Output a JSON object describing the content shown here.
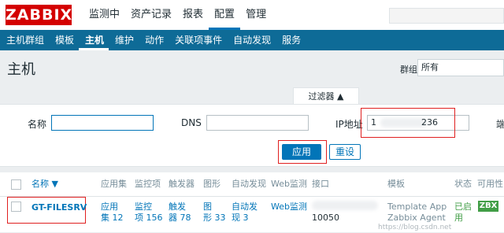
{
  "top": {
    "logo": "ZABBIX",
    "nav": [
      "监测中",
      "资产记录",
      "报表",
      "配置",
      "管理"
    ],
    "active_nav": "配置"
  },
  "subnav": [
    "主机群组",
    "模板",
    "主机",
    "维护",
    "动作",
    "关联项事件",
    "自动发现",
    "服务"
  ],
  "page": {
    "title": "主机",
    "group_label": "群组",
    "group_value": "所有"
  },
  "filter": {
    "tab_label": "过滤器 ▲",
    "name_label": "名称",
    "name_value": "",
    "dns_label": "DNS",
    "dns_value": "",
    "ip_label": "IP地址",
    "ip_prefix": "1",
    "ip_suffix": "236",
    "port_label_partial": "端",
    "apply_label": "应用",
    "reset_label": "重设"
  },
  "table": {
    "headers": {
      "name": "名称 ▼",
      "apps": "应用集",
      "items": "监控项",
      "triggers": "触发器",
      "graphs": "图形",
      "discovery": "自动发现",
      "web": "Web监测",
      "interface": "接口",
      "template": "模板",
      "status": "状态",
      "availability": "可用性"
    },
    "row": {
      "name": "GT-FILESRV",
      "apps_line1": "应用",
      "apps_line2": "集 12",
      "items_line1": "监控",
      "items_line2": "项 156",
      "triggers_line1": "触发",
      "triggers_line2": "器 78",
      "graphs_line1": "图",
      "graphs_line2": "形 33",
      "discovery_line1": "自动发",
      "discovery_line2": "现 3",
      "web": "Web监测",
      "interface_port": "10050",
      "template_line1": "Template App",
      "template_line2": "Zabbix Agent",
      "status_line1": "已启",
      "status_line2": "用",
      "availability_badge": "ZBX"
    }
  },
  "watermark": "https://blog.csdn.net"
}
